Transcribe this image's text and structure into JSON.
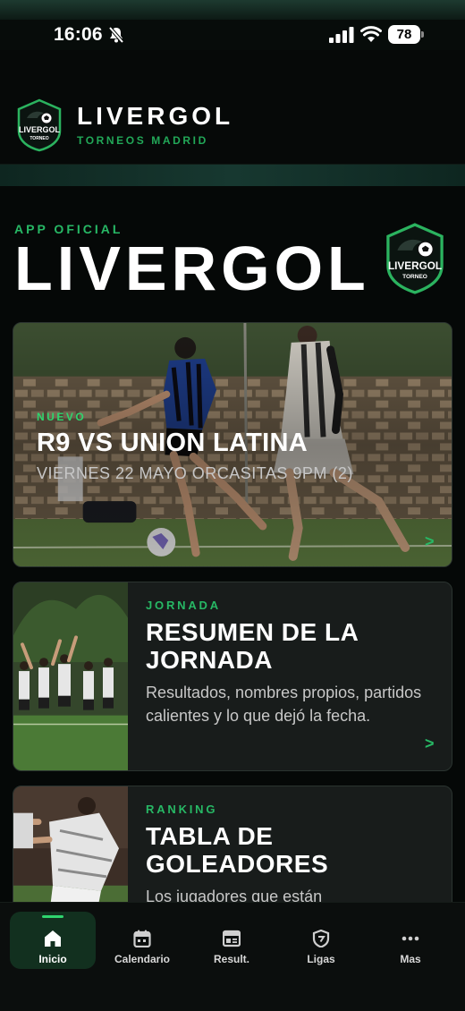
{
  "status_bar": {
    "time": "16:06",
    "battery": "78"
  },
  "header": {
    "title": "LIVERGOL",
    "subtitle": "TORNEOS MADRID",
    "logo_text": "LIVERGOL",
    "logo_subtext": "TORNEO"
  },
  "hero": {
    "eyebrow": "APP OFICIAL",
    "title": "LIVERGOL"
  },
  "featured": {
    "tag": "NUEVO",
    "title": "R9 VS UNION LATINA",
    "subtitle": "VIERNES 22 MAYO ORCASITAS 9PM (2)",
    "chevron": ">"
  },
  "cards": [
    {
      "tag": "JORNADA",
      "title": "RESUMEN DE LA JORNADA",
      "description": "Resultados, nombres propios, partidos calientes y lo que dejó la fecha.",
      "chevron": ">"
    },
    {
      "tag": "RANKING",
      "title": "TABLA DE GOLEADORES",
      "description": "Los jugadores que están"
    }
  ],
  "nav": {
    "active": "Inicio",
    "items": [
      {
        "label": "Inicio",
        "icon": "home-icon"
      },
      {
        "label": "Calendario",
        "icon": "calendar-icon"
      },
      {
        "label": "Result.",
        "icon": "results-icon"
      },
      {
        "label": "Ligas",
        "icon": "shield-icon"
      },
      {
        "label": "Mas",
        "icon": "more-icon"
      }
    ]
  },
  "colors": {
    "accent": "#27b865",
    "background": "#050807",
    "card": "#181c1b"
  }
}
